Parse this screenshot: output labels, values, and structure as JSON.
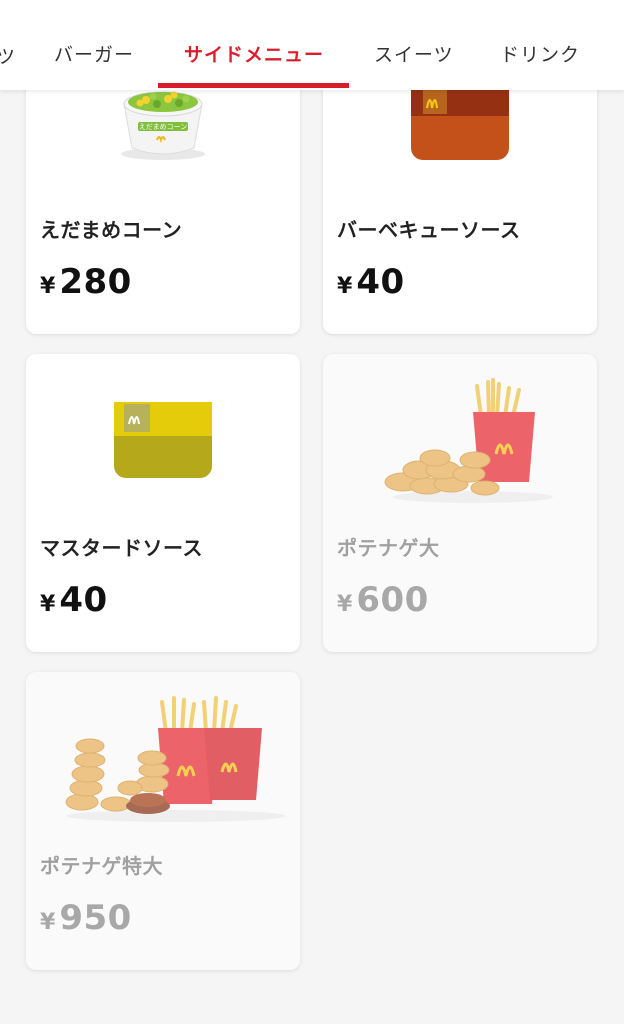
{
  "tabs": [
    {
      "label": "バーガー",
      "active": false
    },
    {
      "label": "サイドメニュー",
      "active": true
    },
    {
      "label": "スイーツ",
      "active": false
    },
    {
      "label": "ドリンク",
      "active": false
    }
  ],
  "tab_partial_glyph": "ツ",
  "accent_color": "#d91d2a",
  "products": [
    {
      "name": "えだまめコーン",
      "currency": "¥",
      "price": "280",
      "available": true,
      "icon": "edamame-corn-cup-image",
      "cup_label": "えだまめコーン"
    },
    {
      "name": "バーベキューソース",
      "currency": "¥",
      "price": "40",
      "available": true,
      "icon": "bbq-sauce-image"
    },
    {
      "name": "マスタードソース",
      "currency": "¥",
      "price": "40",
      "available": true,
      "icon": "mustard-sauce-image"
    },
    {
      "name": "ポテナゲ大",
      "currency": "¥",
      "price": "600",
      "available": false,
      "icon": "fries-nuggets-large-image"
    },
    {
      "name": "ポテナゲ特大",
      "currency": "¥",
      "price": "950",
      "available": false,
      "icon": "fries-nuggets-xl-image"
    }
  ]
}
